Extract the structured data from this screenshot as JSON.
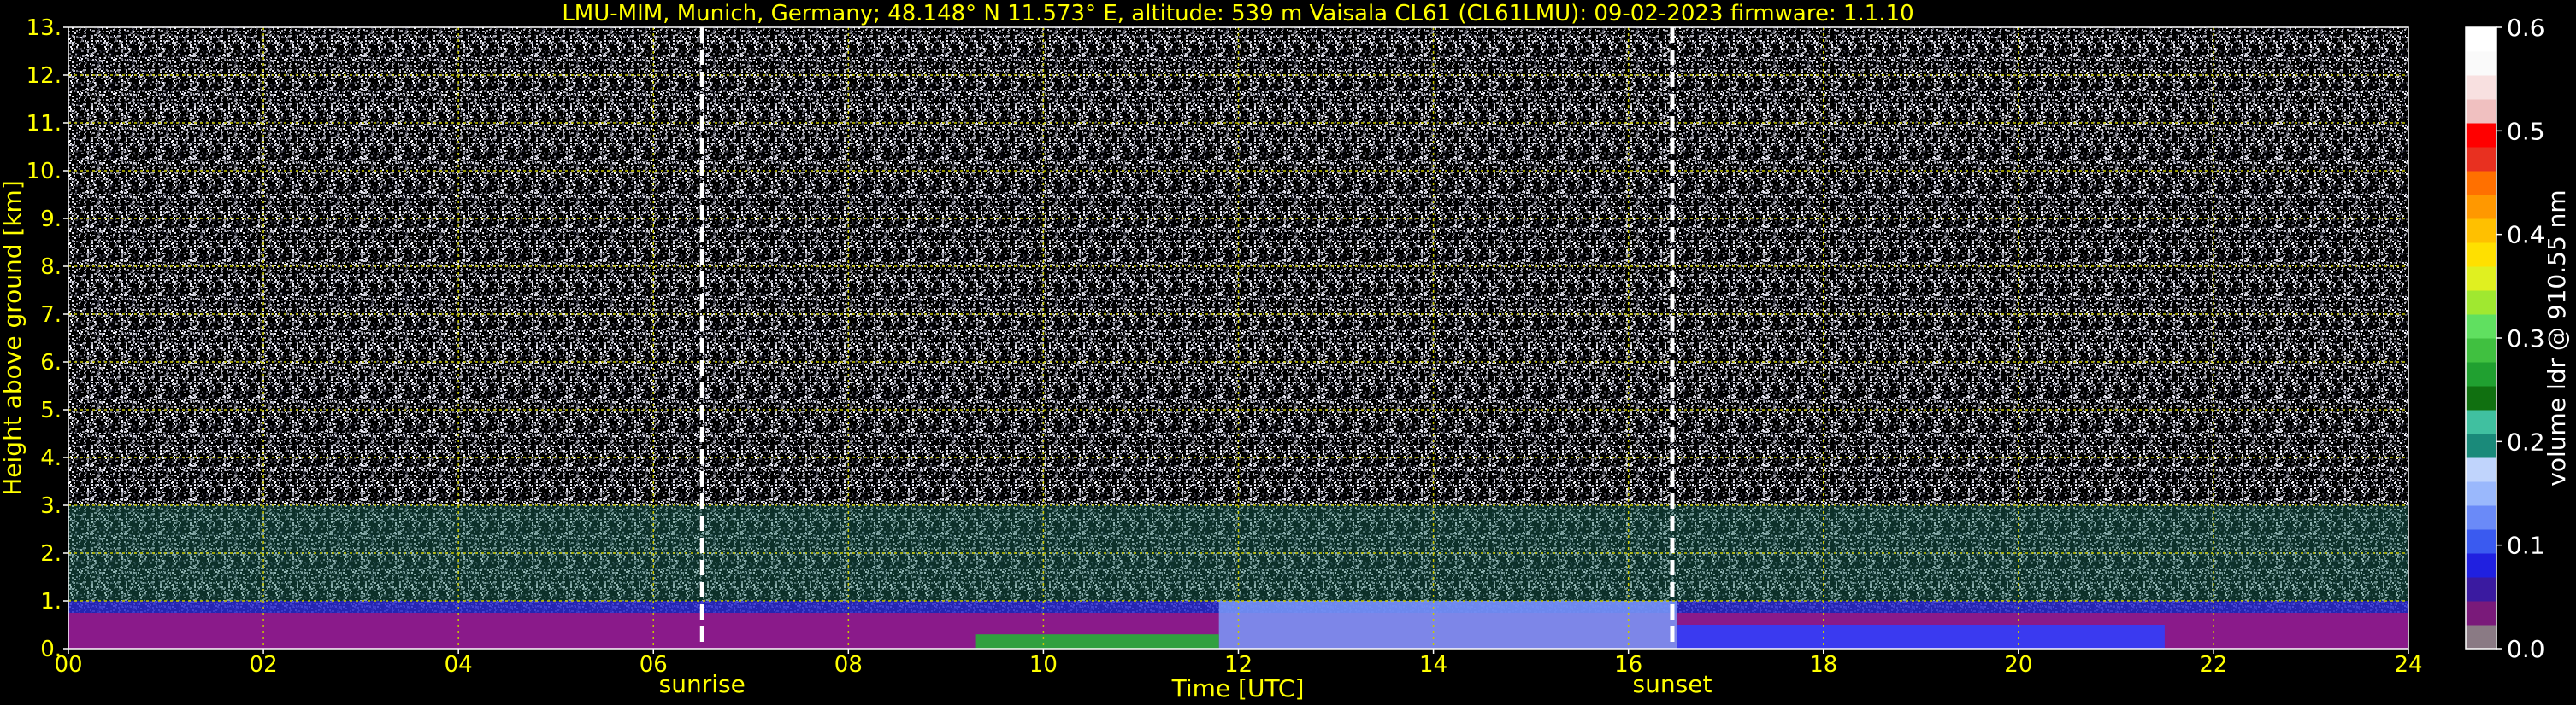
{
  "chart_data": {
    "type": "heatmap",
    "title": "LMU-MIM, Munich, Germany; 48.148° N 11.573° E, altitude: 539 m    Vaisala CL61 (CL61LMU): 09-02-2023    firmware: 1.1.10",
    "xlabel": "Time [UTC]",
    "ylabel": "Height above ground [km]",
    "colorbar_label": "volume ldr @ 910.55 nm",
    "x_range": [
      0,
      24
    ],
    "y_range": [
      0,
      13
    ],
    "x_ticks": [
      "00",
      "02",
      "04",
      "06",
      "08",
      "10",
      "12",
      "14",
      "16",
      "18",
      "20",
      "22",
      "24"
    ],
    "y_ticks": [
      "0.",
      "1.",
      "2.",
      "3.",
      "4.",
      "5.",
      "6.",
      "7.",
      "8.",
      "9.",
      "10.",
      "11.",
      "12.",
      "13."
    ],
    "colorbar_ticks": [
      "0.0",
      "0.1",
      "0.2",
      "0.3",
      "0.4",
      "0.5",
      "0.6"
    ],
    "colorbar_range": [
      0,
      0.6
    ],
    "grid": true,
    "colorbar_colors": [
      "#8a7a84",
      "#7a1a7a",
      "#3a1aa0",
      "#2020e0",
      "#3a5af0",
      "#6a8af8",
      "#9ab8fc",
      "#c0d4fc",
      "#1a8a7a",
      "#40c0a0",
      "#107010",
      "#20a030",
      "#40c040",
      "#60e060",
      "#a0e830",
      "#e0f020",
      "#ffe000",
      "#ffc000",
      "#ff9800",
      "#ff7000",
      "#e83020",
      "#ff0000",
      "#f0c0c0",
      "#f8e0e0",
      "#fafafa",
      "#ffffff"
    ],
    "annotations": [
      {
        "text": "sunrise",
        "x": 6.5
      },
      {
        "text": "sunset",
        "x": 16.45
      }
    ]
  }
}
